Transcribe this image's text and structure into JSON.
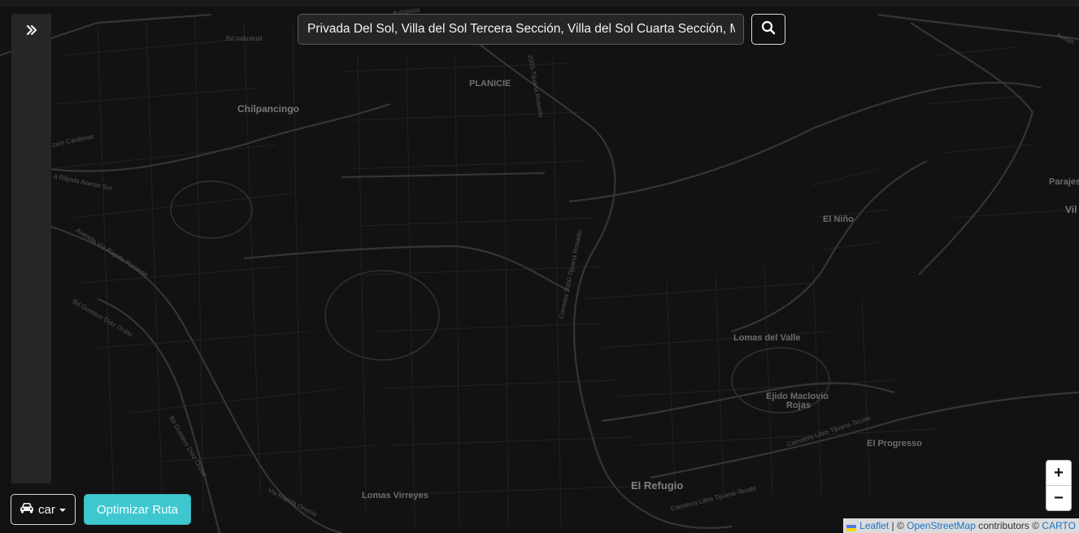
{
  "sidebar": {
    "toggle_icon": "double-chevron-right-icon"
  },
  "search": {
    "value": "Privada Del Sol, Villa del Sol Tercera Sección, Villa del Sol Cuarta Sección, M",
    "button_icon": "search-icon"
  },
  "controls": {
    "vehicle_icon": "car-icon",
    "vehicle_label": "car",
    "optimize_label": "Optimizar Ruta"
  },
  "zoom": {
    "in_label": "+",
    "out_label": "−"
  },
  "attribution": {
    "leaflet": "Leaflet",
    "separator": " | © ",
    "osm": "OpenStreetMap",
    "contributors": " contributors © ",
    "carto": "CARTO"
  },
  "map_labels": {
    "planicie": "PLANICIE",
    "chilpancingo": "Chilpancingo",
    "el_nino": "El Niño",
    "lomas_del_valle": "Lomas del Valle",
    "ejido_maclovio": "Ejido Maclovio",
    "rojas": "Rojas",
    "el_progresso": "El Progresso",
    "el_refugio": "El Refugio",
    "lomas_virreyes": "Lomas Virreyes",
    "parajes": "Parajes",
    "vil": "Vil"
  },
  "road_labels": {
    "bd_industrial": "Bd Industrial",
    "lazaro_cardenas": "zaro Cardenas",
    "via_rapida_alamar_sur": "a Rápida Alamar Sur",
    "avenida_via_rapida_poniente": "Avenida Via Rápida Poniente",
    "bd_gustavo_diaz_ordaz": "Bd Gustavo Díaz Ordaz",
    "bd_gustavo_diaz_ordaz_2": "Bd Gustavo Díaz Ordaz",
    "corredor_2000": "Corredor 2000-Tijuana Rosarito",
    "tijuana_rosarito_top": "2000-Tijuana Rosarito",
    "carretera_libre": "Carretera Libre Tijuana-Tecate",
    "carretera_libre_2": "Carretera Libre Tijuana-Tecate",
    "via_rapida_oriente": "Via Rápida Oriente",
    "autopista": "Autopista",
    "autopista_2": "Autopi"
  },
  "colors": {
    "map_background": "#121212",
    "road": "#2e2e2e",
    "major_road": "#3a3a3a",
    "optimize_button": "#3fc7cf",
    "sidebar": "#262626"
  }
}
